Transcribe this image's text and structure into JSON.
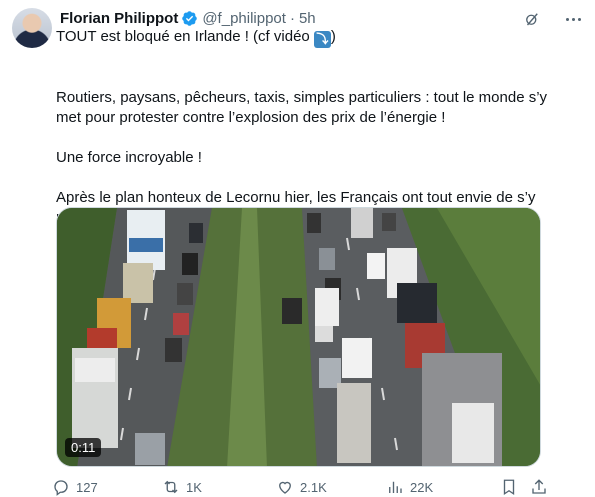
{
  "post": {
    "author": {
      "display_name": "Florian Philippot",
      "handle": "@f_philippot",
      "separator": "·",
      "time": "5h",
      "verified": true
    },
    "text": {
      "line1_before": "TOUT est bloqué en Irlande ! (cf vidéo",
      "line1_after": ")",
      "arrow_emoji": "⤵",
      "paragraph2": "Routiers, paysans, pêcheurs, taxis, simples particuliers : tout le monde s’y met pour protester contre l’explosion des prix de l’énergie !",
      "paragraph3": "Une force incroyable !",
      "paragraph4": "Après le plan honteux de Lecornu hier, les Français ont tout envie de s’y mettre !"
    },
    "media": {
      "type": "video",
      "duration": "0:11"
    },
    "metrics": {
      "replies": "127",
      "reposts": "1K",
      "likes": "2.1K",
      "views": "22K"
    }
  },
  "colors": {
    "accent": "#1d9bf0",
    "secondary_text": "#536471"
  },
  "icons": [
    "grok-icon",
    "more-icon",
    "verified-badge-icon",
    "reply-icon",
    "repost-icon",
    "like-icon",
    "views-icon",
    "bookmark-icon"
  ]
}
